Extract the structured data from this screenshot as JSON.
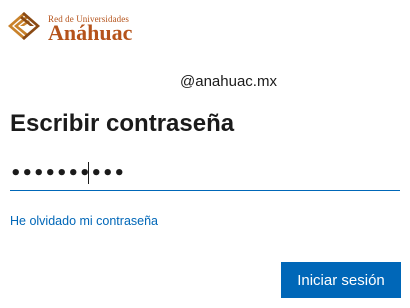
{
  "logo": {
    "line1": "Red de Universidades",
    "line2": "Anáhuac",
    "icon": "anahuac-logo-icon",
    "brand_color": "#b5531b"
  },
  "account": {
    "identity": "@anahuac.mx"
  },
  "heading": "Escribir contraseña",
  "password": {
    "value": "••••••••••"
  },
  "links": {
    "forgot_password": "He olvidado mi contraseña"
  },
  "actions": {
    "signin_label": "Iniciar sesión"
  },
  "colors": {
    "accent": "#0067b8",
    "text": "#1b1b1b",
    "background": "#ffffff"
  }
}
